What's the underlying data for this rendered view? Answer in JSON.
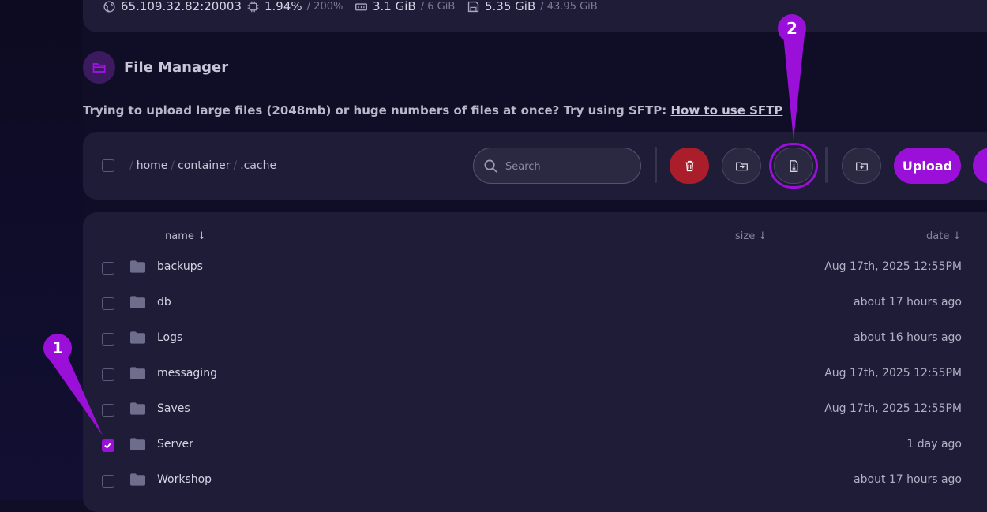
{
  "stats": {
    "address": "65.109.32.82:20003",
    "cpu": "1.94%",
    "cpu_limit": "/ 200%",
    "memory": "3.1 GiB",
    "memory_limit": "/ 6 GiB",
    "disk": "5.35 GiB",
    "disk_limit": "/ 43.95 GiB"
  },
  "header": {
    "title": "File Manager",
    "icon": "folder-open-icon"
  },
  "sftp_note": {
    "text": "Trying to upload large files (2048mb) or huge numbers of files at once? Try using SFTP:",
    "link": "How to use SFTP"
  },
  "toolbar": {
    "breadcrumb": [
      "home",
      "container",
      ".cache"
    ],
    "search_placeholder": "Search",
    "upload_label": "Upload",
    "colors": {
      "accent": "#9b10d8",
      "danger": "#a91e2a"
    }
  },
  "table": {
    "columns": {
      "name": "name ↓",
      "size": "size ↓",
      "date": "date ↓"
    },
    "rows": [
      {
        "name": "backups",
        "date": "Aug 17th, 2025 12:55PM",
        "checked": false
      },
      {
        "name": "db",
        "date": "about 17 hours ago",
        "checked": false
      },
      {
        "name": "Logs",
        "date": "about 16 hours ago",
        "checked": false
      },
      {
        "name": "messaging",
        "date": "Aug 17th, 2025 12:55PM",
        "checked": false
      },
      {
        "name": "Saves",
        "date": "Aug 17th, 2025 12:55PM",
        "checked": false
      },
      {
        "name": "Server",
        "date": "1 day ago",
        "checked": true
      },
      {
        "name": "Workshop",
        "date": "about 17 hours ago",
        "checked": false
      }
    ]
  },
  "annotations": {
    "marker_1": "1",
    "marker_2": "2"
  }
}
